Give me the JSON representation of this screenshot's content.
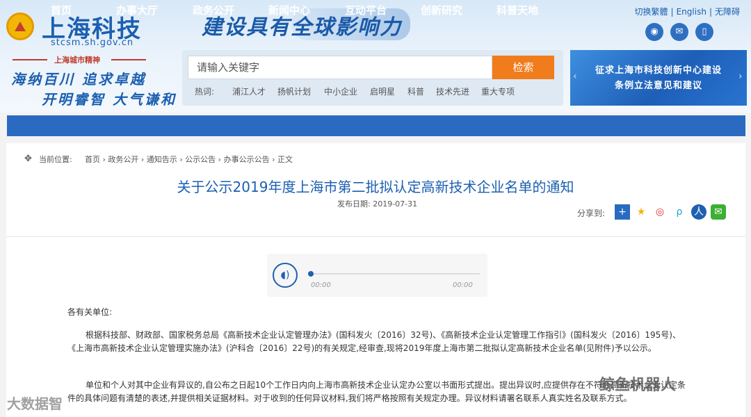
{
  "header": {
    "logo_title": "上海科技",
    "logo_url": "stcsm.sh.gov.cn",
    "spirit_label": "上海城市精神",
    "motto_line1": "海纳百川 追求卓越",
    "motto_line2": "开明睿智 大气谦和",
    "slogan": "建设具有全球影响力"
  },
  "utility": {
    "traditional": "切换繁體",
    "english": "English",
    "accessible": "无障碍",
    "sep": "|"
  },
  "social_icons": [
    "weibo-icon",
    "wechat-icon",
    "mobile-icon"
  ],
  "search": {
    "placeholder": "请输入关键字",
    "button": "检索",
    "hot_label": "热词:",
    "hot_words": [
      "浦江人才",
      "扬帆计划",
      "中小企业",
      "启明星",
      "科普",
      "技术先进",
      "重大专项"
    ]
  },
  "banner": {
    "line1": "征求上海市科技创新中心建设",
    "line2": "条例立法意见和建议"
  },
  "nav": [
    "首页",
    "办事大厅",
    "政务公开",
    "新闻中心",
    "互动平台",
    "创新研究",
    "科普天地"
  ],
  "breadcrumb": {
    "label": "当前位置:",
    "path": "首页 › 政务公开 › 通知告示 › 公示公告 › 办事公示公告 › 正文"
  },
  "article": {
    "title": "关于公示2019年度上海市第二批拟认定高新技术企业名单的通知",
    "date_label": "发布日期:",
    "date": "2019-07-31",
    "share_label": "分享到:",
    "share_icons": [
      "add-share-icon",
      "favorite-icon",
      "weibo-icon",
      "pinterest-icon",
      "renren-icon",
      "wechat-icon"
    ],
    "audio": {
      "current": "00:00",
      "total": "00:00",
      "progress": 0
    },
    "salutation": "各有关单位:",
    "para1": "根据科技部、财政部、国家税务总局《高新技术企业认定管理办法》(国科发火〔2016〕32号)、《高新技术企业认定管理工作指引》(国科发火〔2016〕195号)、《上海市高新技术企业认定管理实施办法》(沪科合〔2016〕22号)的有关规定,经审查,现将2019年度上海市第二批拟认定高新技术企业名单(见附件)予以公示。",
    "para2": "单位和个人对其中企业有异议的,自公布之日起10个工作日内向上海市高新技术企业认定办公室以书面形式提出。提出异议时,应提供存在不符合高新技术企业认定条件的具体问题有清楚的表述,并提供相关证据材料。对于收到的任何异议材料,我们将严格按照有关规定办理。异议材料请署名联系人真实姓名及联系方式。"
  },
  "watermarks": {
    "left": "大数据智",
    "right": "鲸鱼机器人"
  }
}
